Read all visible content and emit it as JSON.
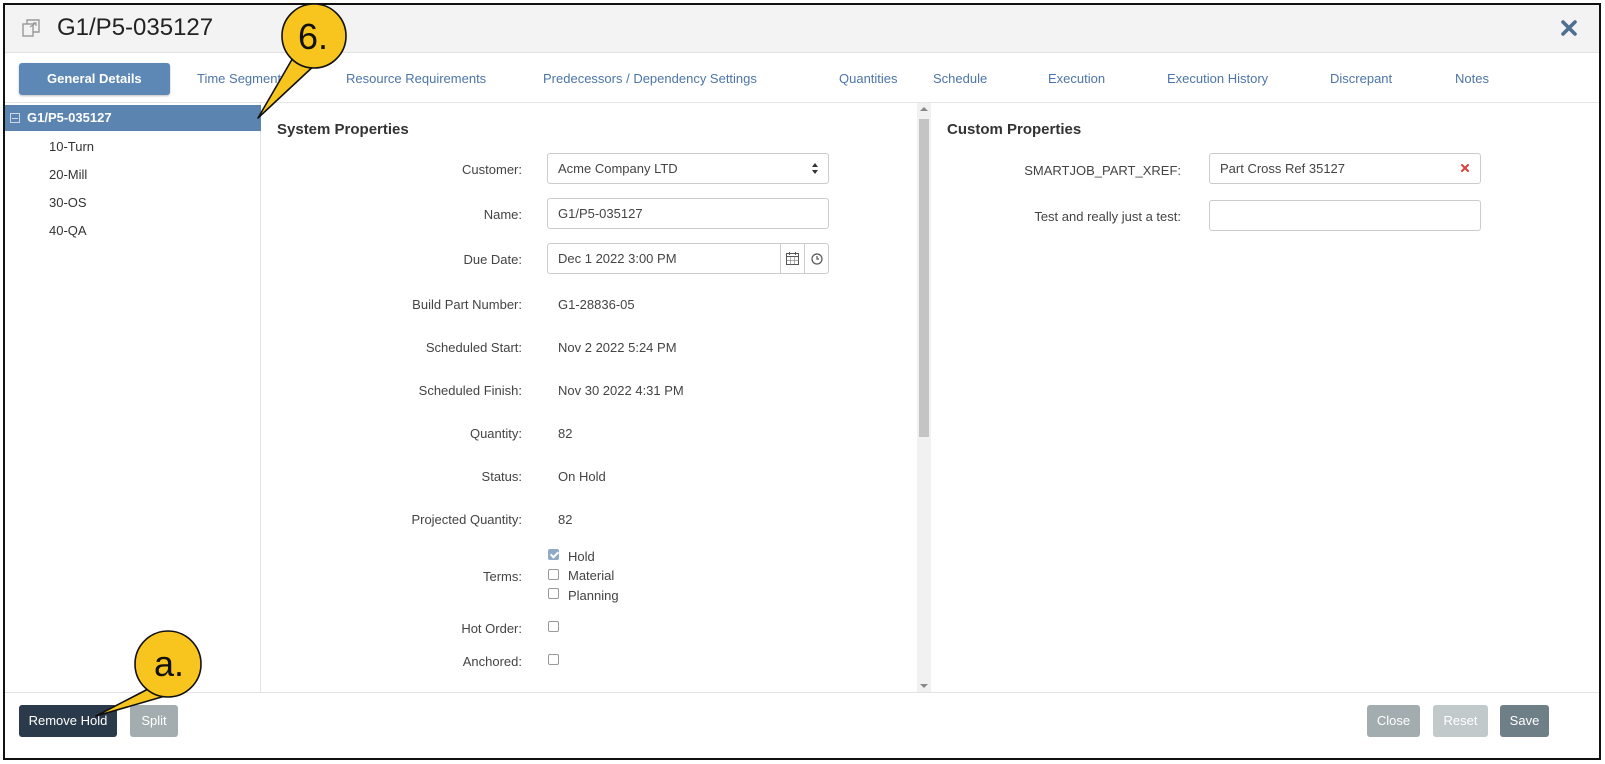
{
  "window": {
    "title": "G1/P5-035127"
  },
  "tabs": [
    {
      "label": "General Details"
    },
    {
      "label": "Time Segments"
    },
    {
      "label": "Resource Requirements"
    },
    {
      "label": "Predecessors / Dependency Settings"
    },
    {
      "label": "Quantities"
    },
    {
      "label": "Schedule"
    },
    {
      "label": "Execution"
    },
    {
      "label": "Execution History"
    },
    {
      "label": "Discrepant"
    },
    {
      "label": "Notes"
    }
  ],
  "tree": {
    "root": "G1/P5-035127",
    "children": [
      "10-Turn",
      "20-Mill",
      "30-OS",
      "40-QA"
    ]
  },
  "system": {
    "title": "System Properties",
    "customer": {
      "label": "Customer:",
      "value": "Acme Company LTD"
    },
    "name": {
      "label": "Name:",
      "value": "G1/P5-035127"
    },
    "due_date": {
      "label": "Due Date:",
      "value": "Dec 1 2022 3:00 PM"
    },
    "build_part": {
      "label": "Build Part Number:",
      "value": "G1-28836-05"
    },
    "sched_start": {
      "label": "Scheduled Start:",
      "value": "Nov 2 2022 5:24 PM"
    },
    "sched_finish": {
      "label": "Scheduled Finish:",
      "value": "Nov 30 2022 4:31 PM"
    },
    "quantity": {
      "label": "Quantity:",
      "value": "82"
    },
    "status": {
      "label": "Status:",
      "value": "On Hold"
    },
    "projected": {
      "label": "Projected Quantity:",
      "value": "82"
    },
    "terms": {
      "label": "Terms:",
      "options": [
        {
          "label": "Hold",
          "checked": true
        },
        {
          "label": "Material",
          "checked": false
        },
        {
          "label": "Planning",
          "checked": false
        }
      ]
    },
    "hot_order": {
      "label": "Hot Order:",
      "checked": false
    },
    "anchored": {
      "label": "Anchored:",
      "checked": false
    }
  },
  "custom": {
    "title": "Custom Properties",
    "xref": {
      "label": "SMARTJOB_PART_XREF:",
      "value": "Part Cross Ref 35127"
    },
    "test": {
      "label": "Test and really just a test:",
      "value": ""
    }
  },
  "footer": {
    "remove_hold": "Remove Hold",
    "split": "Split",
    "close": "Close",
    "reset": "Reset",
    "save": "Save"
  },
  "callouts": {
    "six": "6.",
    "a": "a."
  },
  "colors": {
    "accent": "#5d88b5",
    "tab_text": "#4d75a8",
    "callout_fill": "#f7c51e",
    "remove_red": "#d9413a"
  }
}
